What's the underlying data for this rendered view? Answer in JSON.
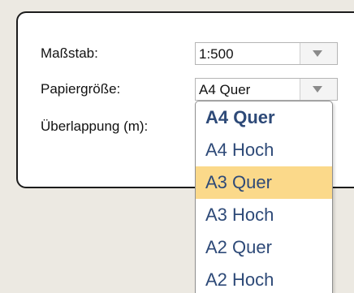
{
  "form": {
    "scale": {
      "label": "Maßstab:",
      "value": "1:500"
    },
    "paper_size": {
      "label": "Papiergröße:",
      "value": "A4 Quer"
    },
    "overlap": {
      "label": "Überlappung (m):"
    }
  },
  "dropdown": {
    "options": [
      "A4 Quer",
      "A4 Hoch",
      "A3 Quer",
      "A3 Hoch",
      "A2 Quer",
      "A2 Hoch"
    ],
    "selected": "A4 Quer",
    "highlighted": "A3 Quer"
  },
  "colors": {
    "option_text": "#2e4a78",
    "highlight": "#fbd98a"
  },
  "icons": {
    "select_arrow": "triangle-down"
  }
}
